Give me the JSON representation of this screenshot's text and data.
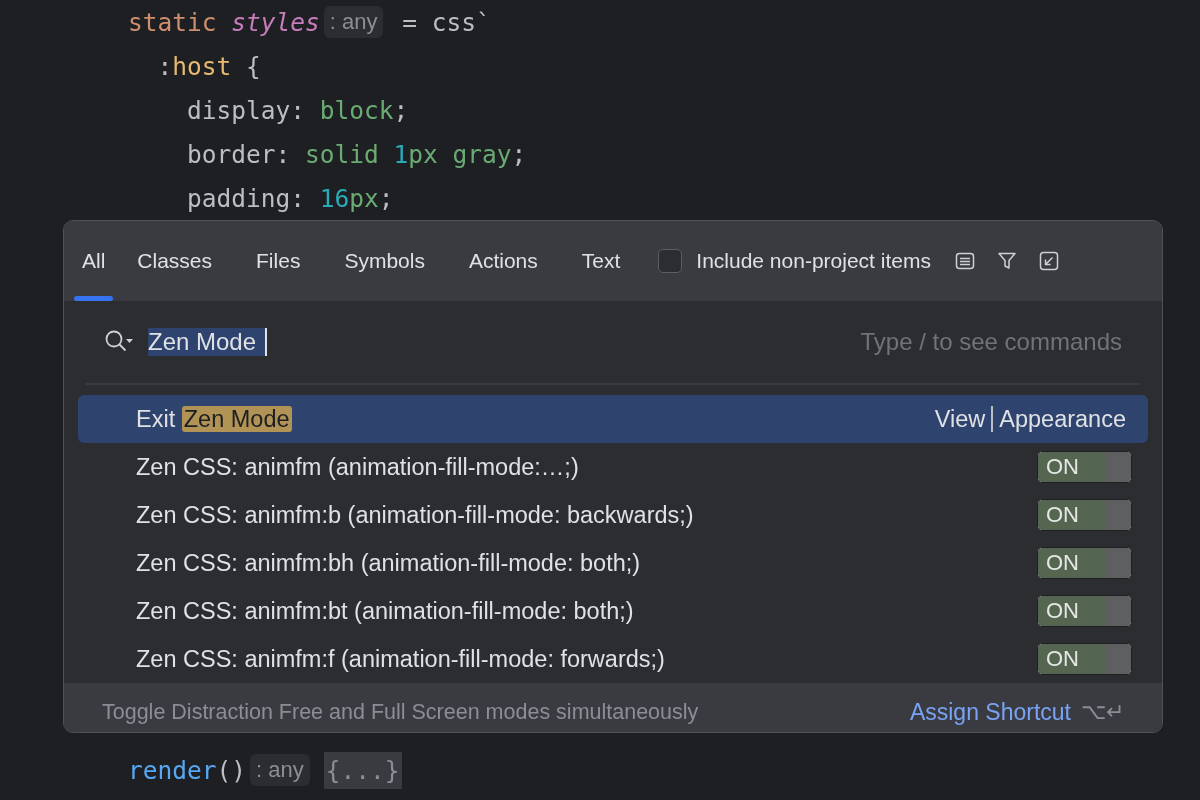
{
  "code_top": [
    [
      {
        "kind": "keyword",
        "text": "static "
      },
      {
        "kind": "field",
        "text": "styles"
      },
      {
        "kind": "hint",
        "text": ": any"
      },
      {
        "kind": "plain",
        "text": " = css`"
      }
    ],
    [
      {
        "kind": "plain",
        "text": "  :"
      },
      {
        "kind": "selector",
        "text": "host"
      },
      {
        "kind": "plain",
        "text": " {"
      }
    ],
    [
      {
        "kind": "plain",
        "text": "    display: "
      },
      {
        "kind": "value",
        "text": "block"
      },
      {
        "kind": "plain",
        "text": ";"
      }
    ],
    [
      {
        "kind": "plain",
        "text": "    border: "
      },
      {
        "kind": "value",
        "text": "solid "
      },
      {
        "kind": "number",
        "text": "1"
      },
      {
        "kind": "value",
        "text": "px gray"
      },
      {
        "kind": "plain",
        "text": ";"
      }
    ],
    [
      {
        "kind": "plain",
        "text": "    padding: "
      },
      {
        "kind": "number",
        "text": "16"
      },
      {
        "kind": "value",
        "text": "px"
      },
      {
        "kind": "plain",
        "text": ";"
      }
    ]
  ],
  "code_bottom": [
    [
      {
        "kind": "function",
        "text": "render"
      },
      {
        "kind": "plain",
        "text": "()"
      },
      {
        "kind": "hint",
        "text": ": any"
      },
      {
        "kind": "folded",
        "text": "{...}"
      }
    ]
  ],
  "popup": {
    "tabs": [
      {
        "label": "All",
        "selected": true
      },
      {
        "label": "Classes",
        "selected": false
      },
      {
        "label": "Files",
        "selected": false
      },
      {
        "label": "Symbols",
        "selected": false
      },
      {
        "label": "Actions",
        "selected": false
      },
      {
        "label": "Text",
        "selected": false
      }
    ],
    "include_checkbox": {
      "label": "Include non-project items",
      "checked": false
    },
    "search": {
      "value": "Zen Mode",
      "placeholder": "Type / to see commands"
    },
    "results": [
      {
        "kind": "action",
        "prefix": "Exit ",
        "match": "Zen Mode",
        "location": [
          "View",
          "Appearance"
        ],
        "selected": true
      },
      {
        "kind": "option",
        "text": "Zen CSS: animfm (animation-fill-mode:…;)",
        "toggle": "ON",
        "on": true,
        "selected": false
      },
      {
        "kind": "option",
        "text": "Zen CSS: animfm:b (animation-fill-mode: backwards;)",
        "toggle": "ON",
        "on": true,
        "selected": false
      },
      {
        "kind": "option",
        "text": "Zen CSS: animfm:bh (animation-fill-mode: both;)",
        "toggle": "ON",
        "on": true,
        "selected": false
      },
      {
        "kind": "option",
        "text": "Zen CSS: animfm:bt (animation-fill-mode: both;)",
        "toggle": "ON",
        "on": true,
        "selected": false
      },
      {
        "kind": "option",
        "text": "Zen CSS: animfm:f (animation-fill-mode: forwards;)",
        "toggle": "ON",
        "on": true,
        "selected": false
      }
    ],
    "footer": {
      "description": "Toggle Distraction Free and Full Screen modes simultaneously",
      "link": "Assign Shortcut",
      "shortcut": "⌥↵"
    }
  }
}
